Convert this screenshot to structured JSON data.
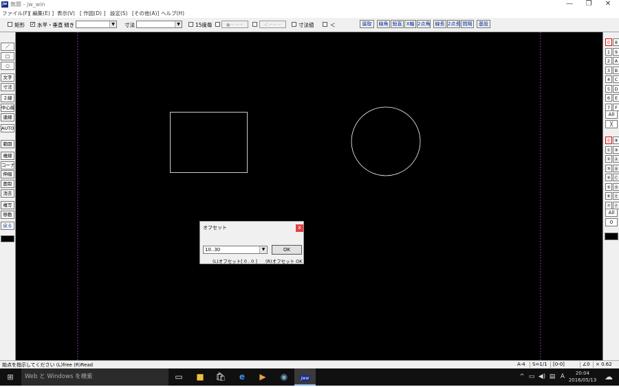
{
  "window": {
    "title": "無題 - jw_win",
    "logo_text": "Jw",
    "minimize": "—",
    "maximize": "❐",
    "close": "✕"
  },
  "menu": [
    "ファイル(F)",
    "[ 編集(E) ]",
    "表示(V)",
    "[ 作図(D) ]",
    "設定(S)",
    "[その他(A)]",
    "ヘルプ(H)"
  ],
  "toolbar": {
    "rect_label": "矩形",
    "hv_label": "水平・垂直",
    "angle_label": "傾き",
    "angle_value": "",
    "dim_label": "寸法",
    "dim_value": "",
    "deg15_label": "15度毎",
    "gray1": "●－－－",
    "gray2": "＜－－－",
    "dimval_label": "寸法値",
    "lt_label": "＜",
    "buttons": [
      "属取",
      "線角",
      "鉛直",
      "X軸",
      "2点角",
      "線長",
      "2点長",
      "間隔",
      "基設"
    ]
  },
  "left_tools": [
    "／",
    "□",
    "○",
    "文字",
    "寸法",
    "２線",
    "中心線",
    "連線",
    "AUTO",
    "範囲",
    "複線",
    "コーナー",
    "伸縮",
    "面取",
    "消去",
    "複写",
    "移動",
    "戻る"
  ],
  "right_panel": {
    "layers_top": [
      [
        "0",
        "8"
      ],
      [
        "1",
        "9"
      ],
      [
        "2",
        "A"
      ],
      [
        "3",
        "B"
      ],
      [
        "4",
        "C"
      ],
      [
        "5",
        "D"
      ],
      [
        "6",
        "E"
      ],
      [
        "7",
        "F"
      ]
    ],
    "all1": "All",
    "cross": "╳",
    "groups": [
      [
        "⓪",
        "⑧"
      ],
      [
        "①",
        "⑨"
      ],
      [
        "②",
        "Ⓐ"
      ],
      [
        "③",
        "Ⓑ"
      ],
      [
        "④",
        "Ⓒ"
      ],
      [
        "⑤",
        "Ⓓ"
      ],
      [
        "⑥",
        "Ⓔ"
      ],
      [
        "⑦",
        "Ⓕ"
      ]
    ],
    "all2": "All",
    "zero": "0"
  },
  "dialog": {
    "title": "オフセット",
    "close": "x",
    "value": "10..30",
    "arrow": "▼",
    "ok": "OK",
    "hint_left": "(L)オフセット[ 0 . 0 ]",
    "hint_right": "(R)オフセット OK"
  },
  "status": {
    "message": "始点を指示してください (L)free (R)Read",
    "paper": "A-4",
    "scale": "S=1/1",
    "layer": "[0-0]",
    "angle": "∠0",
    "zoom": "× 0.62"
  },
  "taskbar": {
    "search": "Web と Windows を検索",
    "time": "20:04",
    "date": "2016/05/13",
    "ime": "A"
  }
}
